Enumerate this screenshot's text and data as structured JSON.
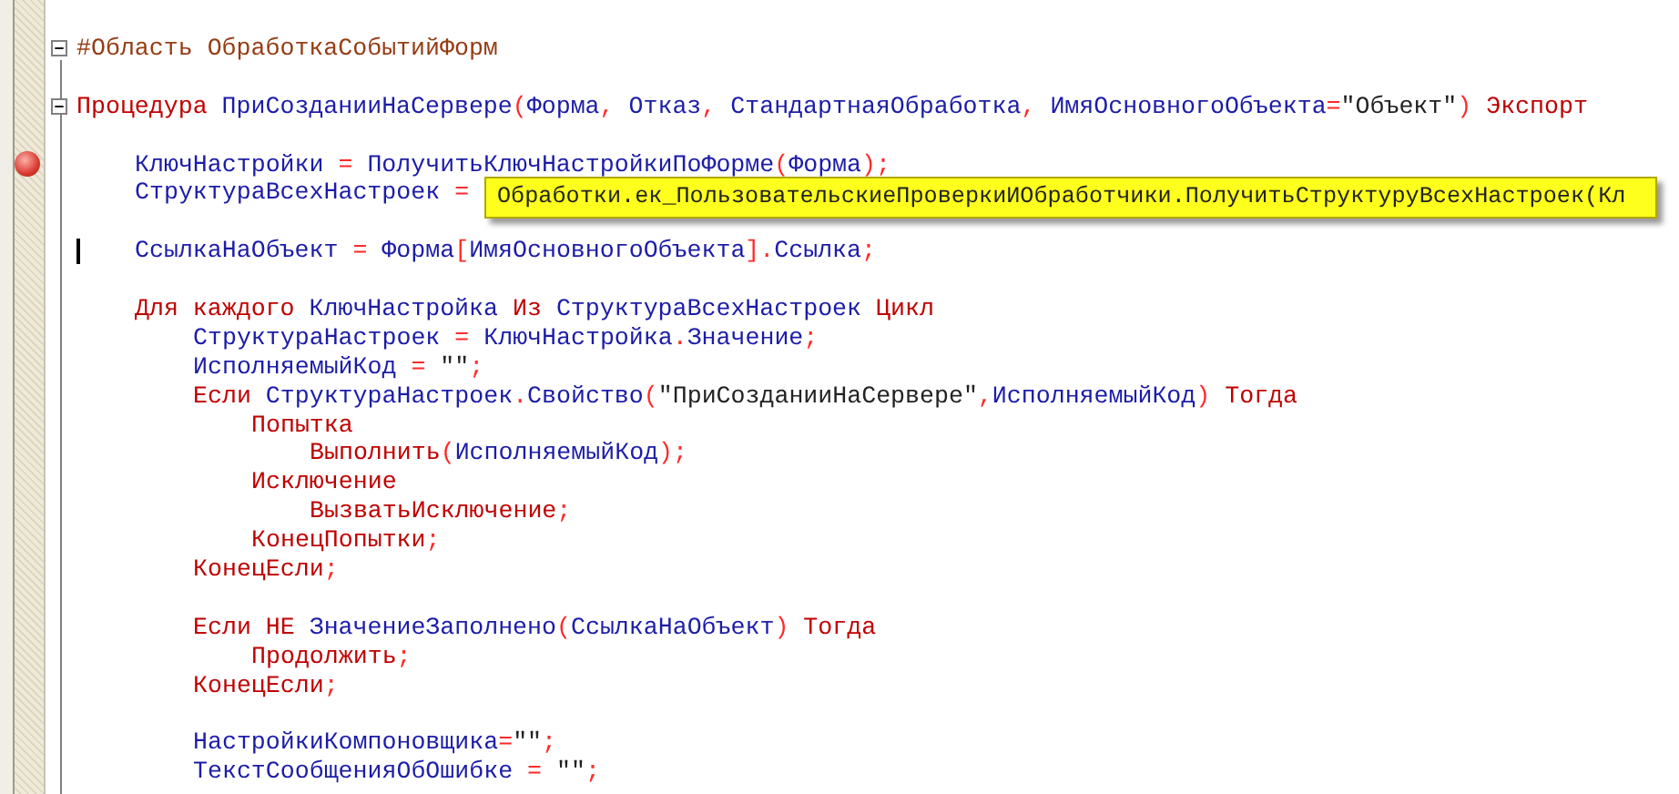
{
  "editor": {
    "lines": [
      {
        "kind": "code",
        "expanded": true,
        "tokens": [
          {
            "kind": "directive",
            "text": "#Область ОбработкаСобытийФорм"
          }
        ]
      },
      {
        "kind": "blank"
      },
      {
        "kind": "code",
        "expanded": true,
        "tokens": [
          {
            "kind": "keyword",
            "text": "Процедура "
          },
          {
            "kind": "name",
            "text": "ПриСозданииНаСервере"
          },
          {
            "kind": "operator",
            "text": "("
          },
          {
            "kind": "name",
            "text": "Форма"
          },
          {
            "kind": "operator",
            "text": ", "
          },
          {
            "kind": "name",
            "text": "Отказ"
          },
          {
            "kind": "operator",
            "text": ", "
          },
          {
            "kind": "name",
            "text": "СтандартнаяОбработка"
          },
          {
            "kind": "operator",
            "text": ", "
          },
          {
            "kind": "name",
            "text": "ИмяОсновногоОбъекта"
          },
          {
            "kind": "operator",
            "text": "="
          },
          {
            "kind": "string",
            "text": "\"Объект\""
          },
          {
            "kind": "operator",
            "text": ") "
          },
          {
            "kind": "keyword",
            "text": "Экспорт"
          }
        ],
        "children": [
          {
            "kind": "blank"
          },
          {
            "kind": "code",
            "breakpoint": true,
            "tokens": [
              {
                "kind": "name",
                "text": "КлючНастройки "
              },
              {
                "kind": "operator",
                "text": "= "
              },
              {
                "kind": "name",
                "text": "ПолучитьКлючНастройкиПоФорме"
              },
              {
                "kind": "operator",
                "text": "("
              },
              {
                "kind": "name",
                "text": "Форма"
              },
              {
                "kind": "operator",
                "text": ");"
              }
            ]
          },
          {
            "kind": "code",
            "tokens": [
              {
                "kind": "name",
                "text": "СтруктураВсехНастроек "
              },
              {
                "kind": "operator",
                "text": "="
              }
            ]
          },
          {
            "kind": "blank"
          },
          {
            "kind": "code",
            "cursor": true,
            "tokens": [
              {
                "kind": "name",
                "text": "СсылкаНаОбъект "
              },
              {
                "kind": "operator",
                "text": "= "
              },
              {
                "kind": "name",
                "text": "Форма"
              },
              {
                "kind": "operator",
                "text": "["
              },
              {
                "kind": "name",
                "text": "ИмяОсновногоОбъекта"
              },
              {
                "kind": "operator",
                "text": "]."
              },
              {
                "kind": "name",
                "text": "Ссылка"
              },
              {
                "kind": "operator",
                "text": ";"
              }
            ]
          },
          {
            "kind": "blank"
          },
          {
            "kind": "code",
            "tokens": [
              {
                "kind": "keyword",
                "text": "Для каждого "
              },
              {
                "kind": "name",
                "text": "КлючНастройка "
              },
              {
                "kind": "keyword",
                "text": "Из "
              },
              {
                "kind": "name",
                "text": "СтруктураВсехНастроек "
              },
              {
                "kind": "keyword",
                "text": "Цикл"
              }
            ],
            "children": [
              {
                "kind": "code",
                "tokens": [
                  {
                    "kind": "name",
                    "text": "СтруктураНастроек "
                  },
                  {
                    "kind": "operator",
                    "text": "= "
                  },
                  {
                    "kind": "name",
                    "text": "КлючНастройка"
                  },
                  {
                    "kind": "operator",
                    "text": "."
                  },
                  {
                    "kind": "name",
                    "text": "Значение"
                  },
                  {
                    "kind": "operator",
                    "text": ";"
                  }
                ]
              },
              {
                "kind": "code",
                "tokens": [
                  {
                    "kind": "name",
                    "text": "ИсполняемыйКод "
                  },
                  {
                    "kind": "operator",
                    "text": "= "
                  },
                  {
                    "kind": "string",
                    "text": "\"\""
                  },
                  {
                    "kind": "operator",
                    "text": ";"
                  }
                ]
              },
              {
                "kind": "code",
                "tokens": [
                  {
                    "kind": "keyword",
                    "text": "Если "
                  },
                  {
                    "kind": "name",
                    "text": "СтруктураНастроек"
                  },
                  {
                    "kind": "operator",
                    "text": "."
                  },
                  {
                    "kind": "name",
                    "text": "Свойство"
                  },
                  {
                    "kind": "operator",
                    "text": "("
                  },
                  {
                    "kind": "string",
                    "text": "\"ПриСозданииНаСервере\""
                  },
                  {
                    "kind": "operator",
                    "text": ","
                  },
                  {
                    "kind": "name",
                    "text": "ИсполняемыйКод"
                  },
                  {
                    "kind": "operator",
                    "text": ") "
                  },
                  {
                    "kind": "keyword",
                    "text": "Тогда"
                  }
                ],
                "children": [
                  {
                    "kind": "code",
                    "tokens": [
                      {
                        "kind": "keyword",
                        "text": "Попытка"
                      }
                    ],
                    "children": [
                      {
                        "kind": "code",
                        "tokens": [
                          {
                            "kind": "keyword",
                            "text": "Выполнить"
                          },
                          {
                            "kind": "operator",
                            "text": "("
                          },
                          {
                            "kind": "name",
                            "text": "ИсполняемыйКод"
                          },
                          {
                            "kind": "operator",
                            "text": ");"
                          }
                        ]
                      }
                    ]
                  },
                  {
                    "kind": "code",
                    "tokens": [
                      {
                        "kind": "keyword",
                        "text": "Исключение"
                      }
                    ],
                    "children": [
                      {
                        "kind": "code",
                        "tokens": [
                          {
                            "kind": "keyword",
                            "text": "ВызватьИсключение"
                          },
                          {
                            "kind": "operator",
                            "text": ";"
                          }
                        ]
                      }
                    ]
                  },
                  {
                    "kind": "code",
                    "tokens": [
                      {
                        "kind": "keyword",
                        "text": "КонецПопытки"
                      },
                      {
                        "kind": "operator",
                        "text": ";"
                      }
                    ]
                  }
                ]
              },
              {
                "kind": "code",
                "tokens": [
                  {
                    "kind": "keyword",
                    "text": "КонецЕсли"
                  },
                  {
                    "kind": "operator",
                    "text": ";"
                  }
                ]
              },
              {
                "kind": "blank"
              },
              {
                "kind": "code",
                "tokens": [
                  {
                    "kind": "keyword",
                    "text": "Если НЕ "
                  },
                  {
                    "kind": "name",
                    "text": "ЗначениеЗаполнено"
                  },
                  {
                    "kind": "operator",
                    "text": "("
                  },
                  {
                    "kind": "name",
                    "text": "СсылкаНаОбъект"
                  },
                  {
                    "kind": "operator",
                    "text": ") "
                  },
                  {
                    "kind": "keyword",
                    "text": "Тогда"
                  }
                ],
                "children": [
                  {
                    "kind": "code",
                    "tokens": [
                      {
                        "kind": "keyword",
                        "text": "Продолжить"
                      },
                      {
                        "kind": "operator",
                        "text": ";"
                      }
                    ]
                  }
                ]
              },
              {
                "kind": "code",
                "tokens": [
                  {
                    "kind": "keyword",
                    "text": "КонецЕсли"
                  },
                  {
                    "kind": "operator",
                    "text": ";"
                  }
                ]
              },
              {
                "kind": "blank"
              },
              {
                "kind": "code",
                "tokens": [
                  {
                    "kind": "name",
                    "text": "НастройкиКомпоновщика"
                  },
                  {
                    "kind": "operator",
                    "text": "="
                  },
                  {
                    "kind": "string",
                    "text": "\"\""
                  },
                  {
                    "kind": "operator",
                    "text": ";"
                  }
                ]
              },
              {
                "kind": "code",
                "tokens": [
                  {
                    "kind": "name",
                    "text": "ТекстСообщенияОбОшибке "
                  },
                  {
                    "kind": "operator",
                    "text": "= "
                  },
                  {
                    "kind": "string",
                    "text": "\"\""
                  },
                  {
                    "kind": "operator",
                    "text": ";"
                  }
                ]
              }
            ]
          }
        ]
      }
    ],
    "tooltip": {
      "text": "Обработки.ек_ПользовательскиеПроверкиИОбработчики.ПолучитьСтруктуруВсехНастроек(Кл"
    }
  }
}
